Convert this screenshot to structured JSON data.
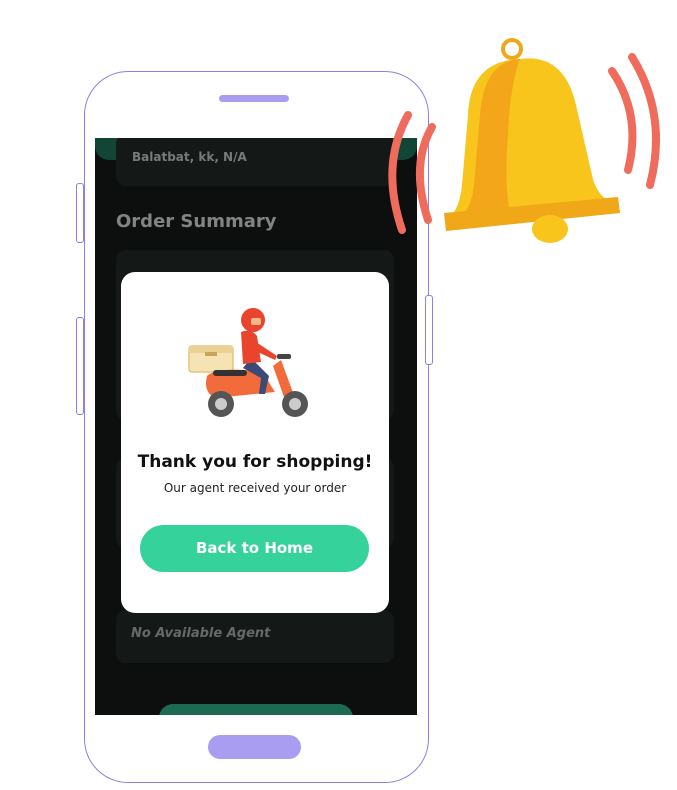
{
  "screen": {
    "address_line": "Balatbat, kk, N/A",
    "order_summary_title": "Order Summary",
    "agent_status": "No Available Agent"
  },
  "modal": {
    "title": "Thank you for shopping!",
    "subtitle": "Our agent received your order",
    "cta_label": "Back to Home",
    "illustration": "delivery-scooter-icon"
  },
  "decoration": {
    "bell": "notification-bell-icon"
  },
  "colors": {
    "cta": "#36d29b",
    "phone_outline": "#8f7fe0",
    "screen_bg": "#141816",
    "accent_dark_green": "#1d6a52",
    "bell_yellow": "#f7c21a",
    "sound_wave": "#ef6b5b"
  }
}
